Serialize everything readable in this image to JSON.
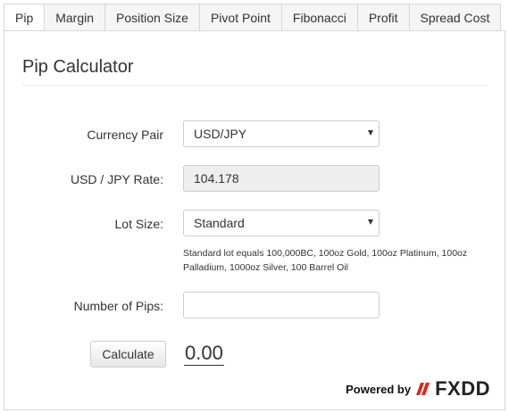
{
  "tabs": [
    {
      "label": "Pip",
      "active": true
    },
    {
      "label": "Margin",
      "active": false
    },
    {
      "label": "Position Size",
      "active": false
    },
    {
      "label": "Pivot Point",
      "active": false
    },
    {
      "label": "Fibonacci",
      "active": false
    },
    {
      "label": "Profit",
      "active": false
    },
    {
      "label": "Spread Cost",
      "active": false
    }
  ],
  "calculator": {
    "title": "Pip Calculator",
    "currency_pair": {
      "label": "Currency Pair",
      "value": "USD/JPY"
    },
    "rate": {
      "label": "USD / JPY Rate:",
      "value": "104.178"
    },
    "lot_size": {
      "label": "Lot Size:",
      "value": "Standard",
      "help": "Standard lot equals 100,000BC, 100oz Gold, 100oz Platinum, 100oz Palladium, 1000oz Silver, 100 Barrel Oil"
    },
    "pips": {
      "label": "Number of Pips:",
      "value": ""
    },
    "calculate_label": "Calculate",
    "result": "0.00"
  },
  "branding": {
    "powered_by": "Powered by",
    "logo_text": "FXDD",
    "logo_accent": "#d9261c"
  }
}
